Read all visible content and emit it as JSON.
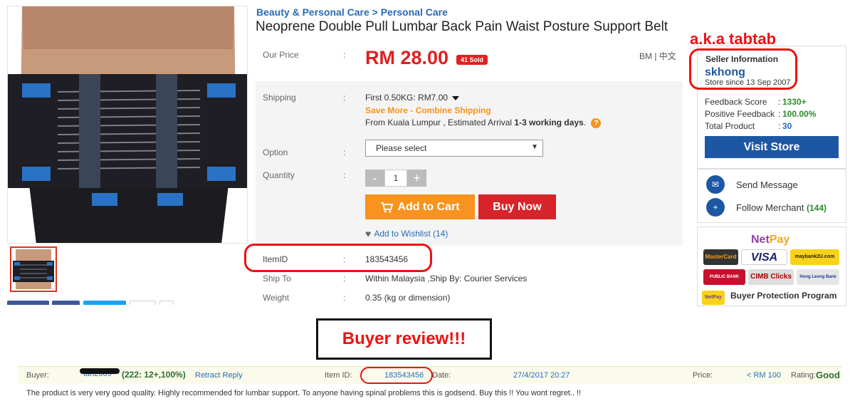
{
  "breadcrumb": {
    "cat1": "Beauty & Personal Care",
    "sep": ">",
    "cat2": "Personal Care"
  },
  "product": {
    "title": "Neoprene Double Pull Lumbar Back Pain Waist Posture Support Belt",
    "price_label": "Our Price",
    "price": "RM 28.00",
    "sold": "41 Sold",
    "lang": "BM | 中文",
    "shipping_label": "Shipping",
    "shipping_value": "First 0.50KG: RM7.00",
    "save_more": "Save More - Combine Shipping",
    "from_prefix": "From Kuala Lumpur , Estimated Arrival ",
    "arrival_days": "1-3 working days",
    "from_suffix": ".",
    "option_label": "Option",
    "option_value": "Please select",
    "quantity_label": "Quantity",
    "quantity_value": "1",
    "qty_minus": "-",
    "qty_plus": "+",
    "add_to_cart": "Add to Cart",
    "buy_now": "Buy Now",
    "wishlist": "Add to Wishlist (14)",
    "itemid_label": "ItemID",
    "itemid_value": "183543456",
    "shipto_label": "Ship To",
    "shipto_value": "Within Malaysia ,Ship By: Courier Services",
    "weight_label": "Weight",
    "weight_value": "0.35 (kg or dimension)",
    "colon": ":"
  },
  "annotations": {
    "aka": "a.k.a tabtab",
    "buyer_review": "Buyer review!!!"
  },
  "seller": {
    "heading": "Seller Information",
    "name": "skhong",
    "since": "Store since 13 Sep 2007",
    "feedback_label": "Feedback Score",
    "feedback_value": "1330+",
    "positive_label": "Positive Feedback",
    "positive_value": "100.00%",
    "total_label": "Total Product",
    "total_value": "30",
    "visit_store": "Visit Store",
    "send_message": "Send Message",
    "follow_prefix": "Follow Merchant ",
    "follow_count": "(144)"
  },
  "payment": {
    "netpay_net": "Net",
    "netpay_pay": "Pay",
    "mastercard": "MasterCard",
    "visa": "VISA",
    "maybank": "maybank2U.com",
    "publicbank": "PUBLIC BANK",
    "cimb": "CIMB Clicks",
    "hongleong": "Hong Leong Bank",
    "netpay_small": "NetPay",
    "buyer_protection": "Buyer Protection Program"
  },
  "review": {
    "buyer_label": "Buyer:",
    "buyer_name": "tan2009",
    "buyer_score": "(222: 12+,100%)",
    "retract": "Retract Reply",
    "itemid_label": "Item ID:",
    "itemid_value": "183543456",
    "date_label": "Date:",
    "date_value": "27/4/2017 20:27",
    "price_label": "Price:",
    "price_value": "< RM 100",
    "rating_label": "Rating:",
    "rating_value": "Good",
    "text": "The product is very very good quality. Highly recommended for lumbar support. To anyone having spinal problems this is godsend. Buy this !! You wont regret.. !!"
  },
  "colors": {
    "accent_blue": "#2a6bb5",
    "price_red": "#e02020",
    "cart_orange": "#f7931e",
    "buy_red": "#d8232a",
    "store_blue": "#1d57a4",
    "highlight_red": "#e11111"
  }
}
